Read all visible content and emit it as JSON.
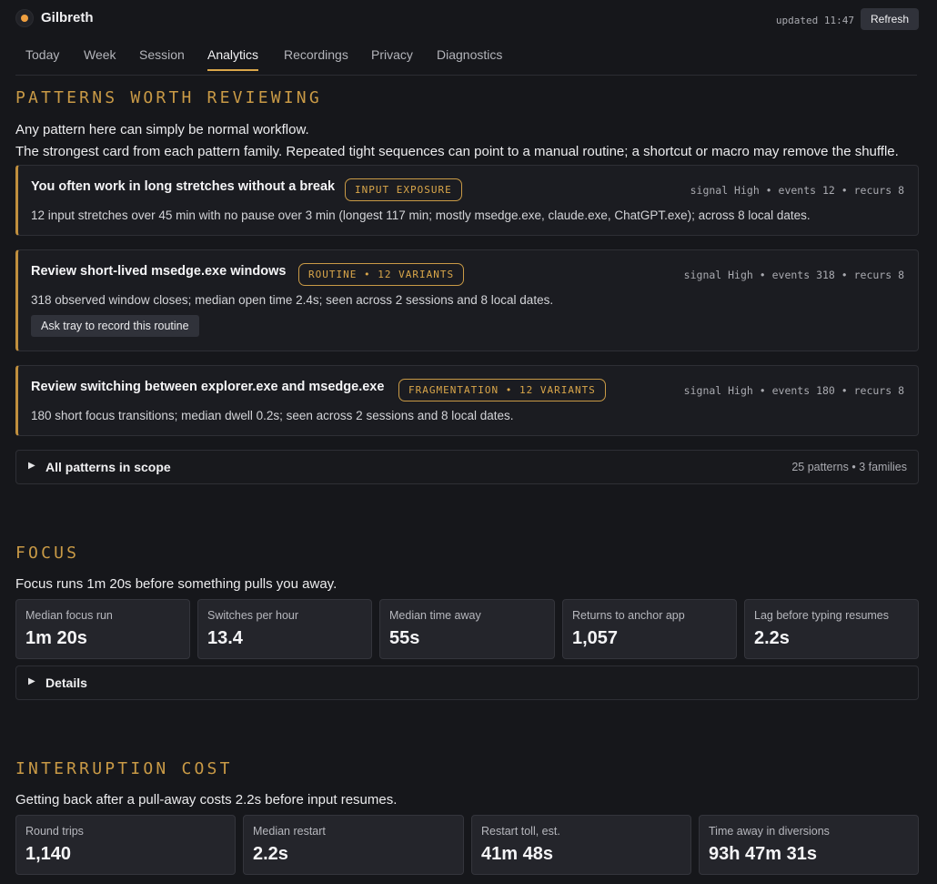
{
  "app": {
    "name": "Gilbreth",
    "updated": "updated 11:47",
    "refresh_label": "Refresh"
  },
  "tabs": [
    {
      "label": "Today"
    },
    {
      "label": "Week"
    },
    {
      "label": "Session"
    },
    {
      "label": "Analytics",
      "active": true
    },
    {
      "label": "Recordings"
    },
    {
      "label": "Privacy"
    },
    {
      "label": "Diagnostics"
    }
  ],
  "patterns": {
    "title": "PATTERNS WORTH REVIEWING",
    "lead1": "Any pattern here can simply be normal workflow.",
    "lead2": "The strongest card from each pattern family. Repeated tight sequences can point to a manual routine; a shortcut or macro may remove the shuffle.",
    "cards": [
      {
        "title": "You often work in long stretches without a break",
        "badge": "INPUT EXPOSURE",
        "meta": "signal High • events 12 • recurs 8",
        "desc": "12 input stretches over 45 min with no pause over 3 min (longest 117 min; mostly msedge.exe, claude.exe, ChatGPT.exe); across 8 local dates."
      },
      {
        "title": "Review short-lived msedge.exe windows",
        "badge": "ROUTINE • 12 VARIANTS",
        "meta": "signal High • events 318 • recurs 8",
        "desc": "318 observed window closes; median open time 2.4s; seen across 2 sessions and 8 local dates.",
        "action": "Ask tray to record this routine"
      },
      {
        "title": "Review switching between explorer.exe and msedge.exe",
        "badge": "FRAGMENTATION • 12 VARIANTS",
        "meta": "signal High • events 180 • recurs 8",
        "desc": "180 short focus transitions; median dwell 0.2s; seen across 2 sessions and 8 local dates."
      }
    ],
    "all_label": "All patterns in scope",
    "all_summary": "25 patterns • 3 families"
  },
  "focus": {
    "title": "FOCUS",
    "lead": "Focus runs 1m 20s before something pulls you away.",
    "metrics": [
      {
        "label": "Median focus run",
        "value": "1m 20s"
      },
      {
        "label": "Switches per hour",
        "value": "13.4"
      },
      {
        "label": "Median time away",
        "value": "55s"
      },
      {
        "label": "Returns to anchor app",
        "value": "1,057"
      },
      {
        "label": "Lag before typing resumes",
        "value": "2.2s"
      }
    ],
    "details_label": "Details"
  },
  "interruption": {
    "title": "INTERRUPTION COST",
    "lead": "Getting back after a pull-away costs 2.2s before input resumes.",
    "metrics": [
      {
        "label": "Round trips",
        "value": "1,140"
      },
      {
        "label": "Median restart",
        "value": "2.2s"
      },
      {
        "label": "Restart toll, est.",
        "value": "41m 48s"
      },
      {
        "label": "Time away in diversions",
        "value": "93h 47m 31s"
      }
    ]
  }
}
